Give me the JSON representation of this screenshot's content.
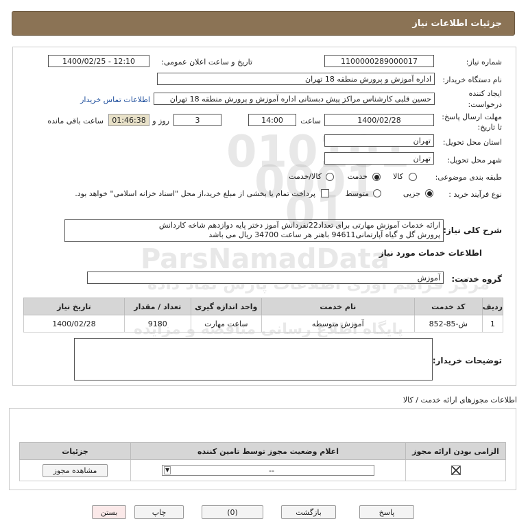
{
  "header": {
    "title": "جزئیات اطلاعات نیاز"
  },
  "form": {
    "need_number_label": "شماره نیاز:",
    "need_number": "1100000289000017",
    "announce_label": "تاریخ و ساعت اعلان عمومی:",
    "announce_value": "1400/02/25 - 12:10",
    "buyer_org_label": "نام دستگاه خریدار:",
    "buyer_org": "اداره آموزش و پرورش منطقه 18 تهران",
    "creator_label_1": "ایجاد کننده",
    "creator_label_2": "درخواست:",
    "creator": "حسین قلبی کارشناس مراکز پیش دبستانی اداره آموزش و پرورش منطقه 18 تهران",
    "contact_link": "اطلاعات تماس خریدار",
    "deadline_label_1": "مهلت ارسال پاسخ:",
    "deadline_label_2": "تا تاریخ:",
    "deadline_date": "1400/02/28",
    "time_label": "ساعت",
    "deadline_time": "14:00",
    "days_value": "3",
    "days_label": "روز و",
    "remaining_time": "01:46:38",
    "remaining_label": "ساعت باقی مانده",
    "province_label": "استان محل تحویل:",
    "province": "تهران",
    "city_label": "شهر محل تحویل:",
    "city": "تهران",
    "category_label": "طبقه بندی موضوعی:",
    "category_options": [
      "کالا",
      "خدمت",
      "کالا/خدمت"
    ],
    "category_selected": "خدمت",
    "process_label": "نوع فرآیند خرید :",
    "process_options": [
      "جزیی",
      "متوسط"
    ],
    "process_selected": "جزیی",
    "payment_note": "پرداخت تمام یا بخشی از مبلغ خرید،از محل \"اسناد خزانه اسلامی\" خواهد بود."
  },
  "description": {
    "label": "شرح کلی نیاز:",
    "line1": "ارائه خدمات آموزش مهارتی برای تعداد22نفردانش آموز دختر پایه دوازدهم شاخه کاردانش",
    "line2": "پرورش گل و گیاه آپارتمانی94611 باهنر هر ساعت 34700 ریال می باشد"
  },
  "services": {
    "section_title": "اطلاعات خدمات مورد نیاز",
    "group_label": "گروه خدمت:",
    "group_value": "آموزش",
    "columns": [
      "ردیف",
      "کد خدمت",
      "نام خدمت",
      "واحد اندازه گیری",
      "تعداد / مقدار",
      "تاریخ نیاز"
    ],
    "rows": [
      [
        "1",
        "ش-85-852",
        "آموزش متوسطه",
        "ساعت مهارت",
        "9180",
        "1400/02/28"
      ]
    ]
  },
  "buyer_notes": {
    "label": "توضیحات خریدار:",
    "value": ""
  },
  "permits": {
    "section_title": "اطلاعات مجوزهای ارائه خدمت / کالا",
    "columns": [
      "الزامی بودن ارائه مجوز",
      "اعلام وضعیت مجوز توسط تامین کننده",
      "جزئیات"
    ],
    "select_value": "--",
    "view_button": "مشاهده مجوز"
  },
  "bottom_buttons": [
    "پاسخ",
    "بازگشت",
    "(0)",
    "چاپ",
    "بستن"
  ],
  "watermark": {
    "brand": "ParsNamadData",
    "line1": "مرکز فراهم آوری اطلاعات پارس نماد داده",
    "line2": "پایگاه اطلاع رسانی مناقصه و مزایده",
    "phone": "۰۲۱-۸۸۳۴۹۶۷۰-۵"
  }
}
